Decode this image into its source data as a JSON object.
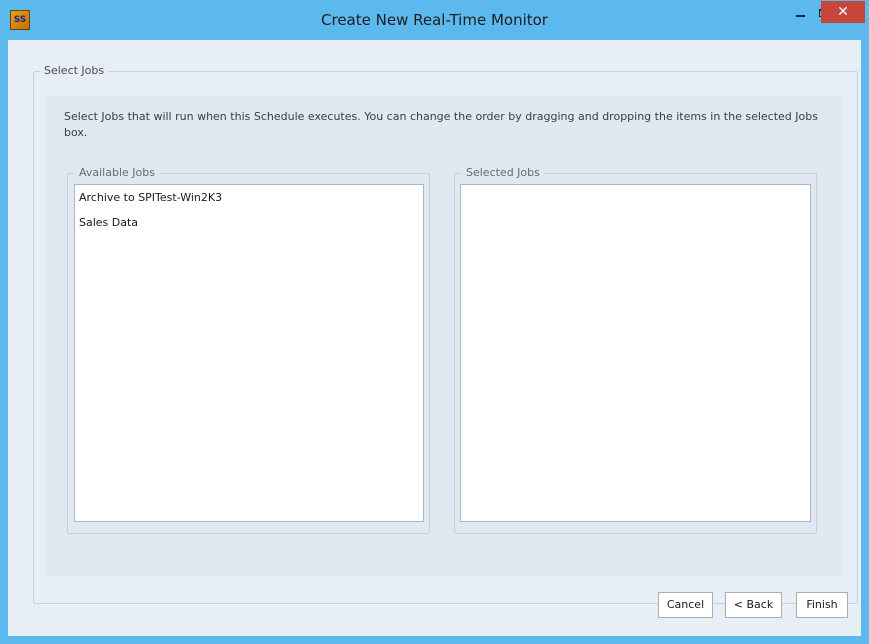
{
  "window": {
    "title": "Create New Real-Time Monitor",
    "app_icon_text": "SS"
  },
  "titlebar_buttons": {
    "close_glyph": "✕"
  },
  "select_jobs": {
    "group_label": "Select Jobs",
    "description": "Select Jobs that will run when this Schedule executes. You can change the order by dragging and dropping the items in the selected Jobs box."
  },
  "available_jobs": {
    "label": "Available Jobs",
    "items": [
      "Archive to SPITest-Win2K3",
      "Sales Data"
    ]
  },
  "selected_jobs": {
    "label": "Selected Jobs",
    "items": []
  },
  "buttons": {
    "cancel": "Cancel",
    "back": "< Back",
    "finish": "Finish"
  }
}
